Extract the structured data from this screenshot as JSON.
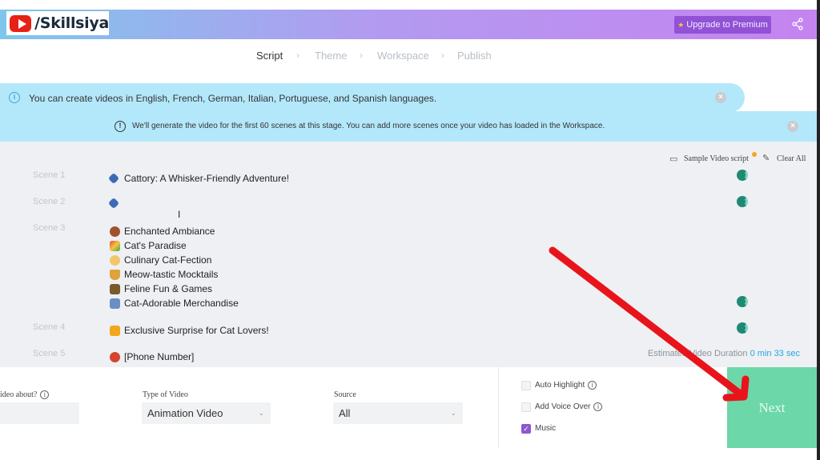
{
  "header": {
    "brand": "/Skillsiya",
    "upgrade_label": "Upgrade to Premium"
  },
  "stepper": [
    "Script",
    "Theme",
    "Workspace",
    "Publish"
  ],
  "alerts": {
    "languages": "You can create videos in English, French, German, Italian, Portuguese, and Spanish languages.",
    "scenes": "We'll generate the video for the first 60 scenes at this stage. You can add more scenes once your video has loaded in the Workspace."
  },
  "tools": {
    "sample": "Sample Video script",
    "clear": "Clear All"
  },
  "scenes": [
    {
      "label": "Scene 1",
      "lines": [
        "Cattory: A Whisker-Friendly Adventure!"
      ]
    },
    {
      "label": "Scene 2",
      "lines": [
        ""
      ]
    },
    {
      "label": "Scene 3",
      "lines": [
        "Enchanted Ambiance",
        "Cat's Paradise",
        "Culinary Cat-Fection",
        "Meow-tastic Mocktails",
        "Feline Fun & Games",
        "Cat-Adorable Merchandise"
      ]
    },
    {
      "label": "Scene 4",
      "lines": [
        "Exclusive Surprise for Cat Lovers!"
      ]
    },
    {
      "label": "Scene 5",
      "lines": [
        "[Phone Number]"
      ]
    }
  ],
  "duration": {
    "label": "Estimated Video Duration",
    "value": "0 min 33 sec"
  },
  "form": {
    "about_label": "ideo about?",
    "type_label": "Type of Video",
    "type_value": "Animation Video",
    "source_label": "Source",
    "source_value": "All"
  },
  "options": {
    "auto_highlight": "Auto Highlight",
    "voice_over": "Add Voice Over",
    "music": "Music",
    "music_checked": true
  },
  "next_label": "Next",
  "colors": {
    "accent_purple": "#9152d6",
    "next_green": "#6cd7a9",
    "alert_blue": "#b3e8fb",
    "annotation_red": "#e8141c"
  }
}
